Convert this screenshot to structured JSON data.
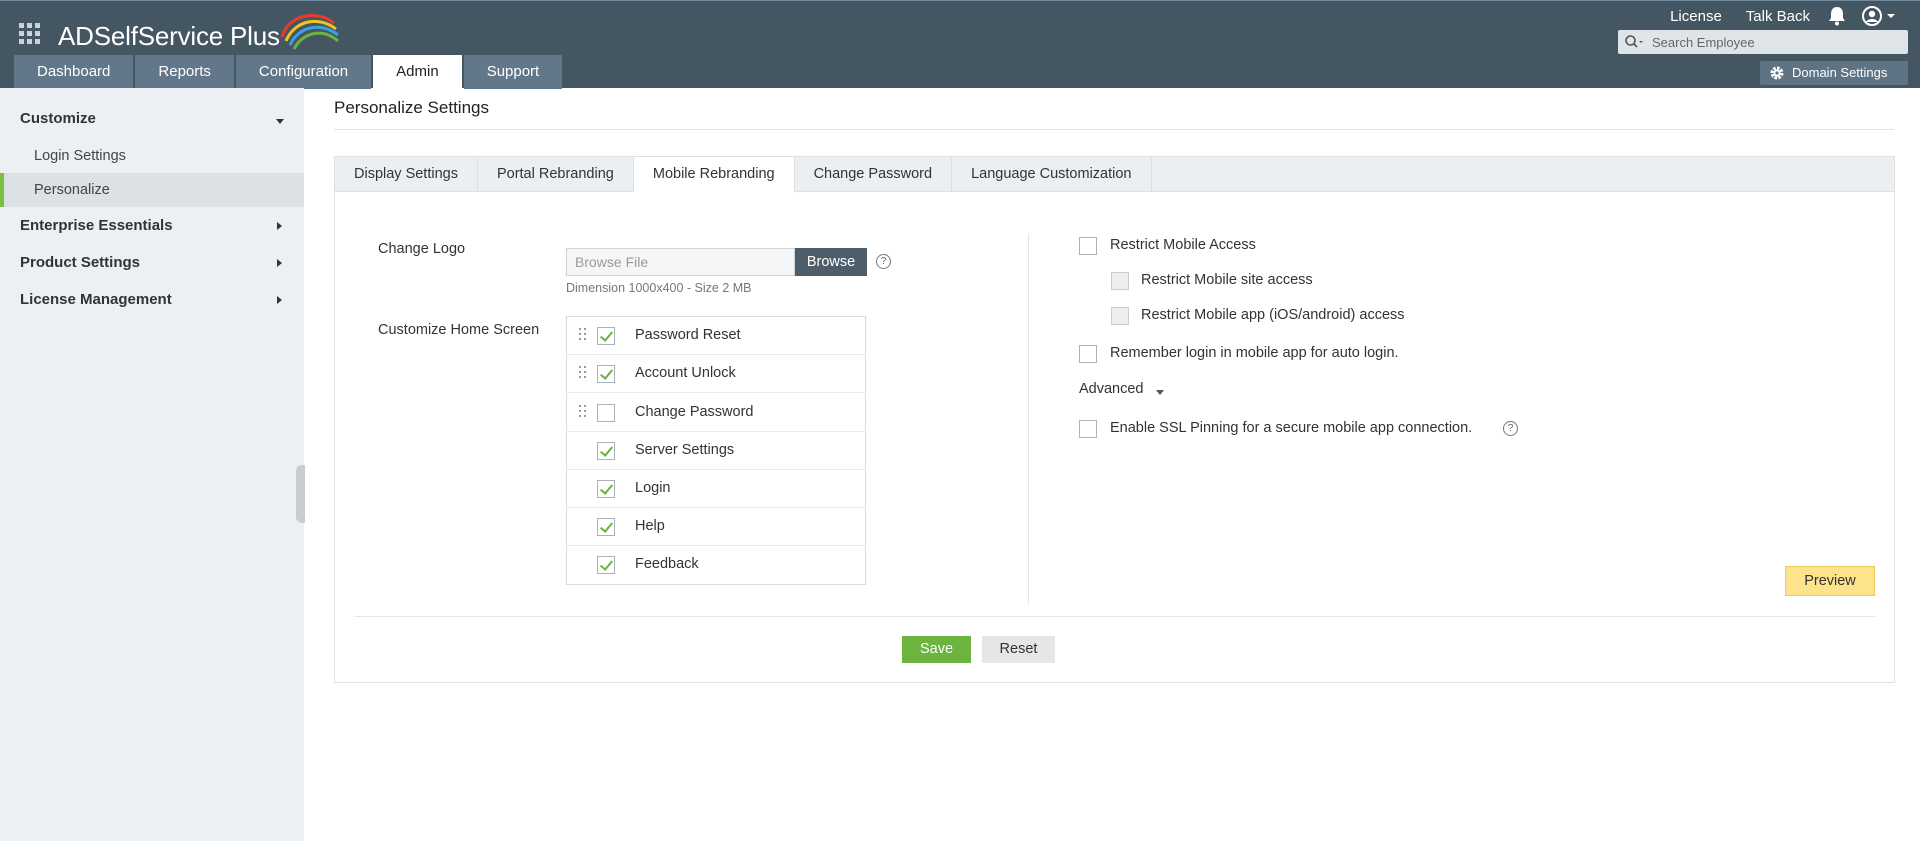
{
  "header": {
    "app_name": "ADSelfService Plus",
    "links": [
      "License",
      "Talk Back"
    ],
    "search_placeholder": "Search Employee",
    "domain_settings": "Domain Settings",
    "icons": {
      "apps": "apps-grid-icon",
      "bell": "bell-icon",
      "user": "user-avatar-icon",
      "search": "search-icon",
      "gear": "gear-icon"
    }
  },
  "main_tabs": [
    {
      "label": "Dashboard",
      "active": false
    },
    {
      "label": "Reports",
      "active": false
    },
    {
      "label": "Configuration",
      "active": false
    },
    {
      "label": "Admin",
      "active": true
    },
    {
      "label": "Support",
      "active": false
    }
  ],
  "sidebar": {
    "sections": [
      {
        "label": "Customize",
        "expanded": true,
        "items": [
          "Login Settings",
          "Personalize"
        ]
      },
      {
        "label": "Enterprise Essentials",
        "expanded": false
      },
      {
        "label": "Product Settings",
        "expanded": false
      },
      {
        "label": "License Management",
        "expanded": false
      }
    ],
    "active_item": "Personalize"
  },
  "page": {
    "title": "Personalize Settings",
    "subtabs": [
      {
        "label": "Display Settings",
        "active": false
      },
      {
        "label": "Portal Rebranding",
        "active": false
      },
      {
        "label": "Mobile Rebranding",
        "active": true
      },
      {
        "label": "Change Password",
        "active": false
      },
      {
        "label": "Language Customization",
        "active": false
      }
    ]
  },
  "form": {
    "change_logo_label": "Change Logo",
    "browse_placeholder": "Browse File",
    "browse_button": "Browse",
    "dimension_note": "Dimension 1000x400 - Size 2 MB",
    "home_screen_label": "Customize Home Screen",
    "home_items": [
      {
        "label": "Password Reset",
        "checked": true,
        "draggable": true
      },
      {
        "label": "Account Unlock",
        "checked": true,
        "draggable": true
      },
      {
        "label": "Change Password",
        "checked": false,
        "draggable": true
      },
      {
        "label": "Server Settings",
        "checked": true,
        "draggable": false
      },
      {
        "label": "Login",
        "checked": true,
        "draggable": false
      },
      {
        "label": "Help",
        "checked": true,
        "draggable": false
      },
      {
        "label": "Feedback",
        "checked": true,
        "draggable": false
      }
    ]
  },
  "options": {
    "restrict_mobile": "Restrict Mobile Access",
    "restrict_site": "Restrict Mobile site access",
    "restrict_app": "Restrict Mobile app (iOS/android) access",
    "remember_login": "Remember login in mobile app for auto login.",
    "advanced": "Advanced",
    "ssl_pinning": "Enable SSL Pinning for a secure mobile app connection.",
    "help_glyph": "?"
  },
  "actions": {
    "preview": "Preview",
    "save": "Save",
    "reset": "Reset"
  },
  "colors": {
    "header_bg": "#455663",
    "tab_bg": "#62788a",
    "accent_green": "#6cb33f",
    "preview_yellow": "#fde48c",
    "sidebar_bg": "#edf0f2"
  }
}
